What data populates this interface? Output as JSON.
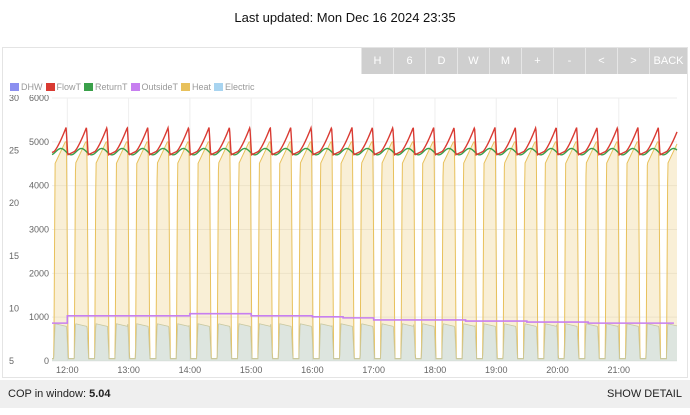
{
  "header": {
    "last_updated": "Last updated: Mon Dec 16 2024 23:35"
  },
  "toolbar": {
    "buttons": [
      "H",
      "6",
      "D",
      "W",
      "M",
      "+",
      "-",
      "<",
      ">",
      "BACK"
    ]
  },
  "footer": {
    "cop_label": "COP in window:",
    "cop_value": "5.04",
    "show_detail": "SHOW DETAIL"
  },
  "chart_data": {
    "type": "line",
    "series": [
      {
        "name": "DHW",
        "color": "#8b8ff0"
      },
      {
        "name": "FlowT",
        "color": "#d93a32",
        "axis": "left",
        "cycle_range": [
          24.6,
          27.2
        ]
      },
      {
        "name": "ReturnT",
        "color": "#3aa04a",
        "axis": "left",
        "cycle_range": [
          24.6,
          25.2
        ]
      },
      {
        "name": "OutsideT",
        "color": "#c77ff0",
        "axis": "left",
        "x": [
          11.75,
          12.0,
          13.5,
          14.0,
          14.5,
          15.0,
          15.5,
          16.0,
          16.5,
          17.0,
          17.5,
          18.0,
          18.5,
          19.0,
          19.5,
          20.0,
          20.5,
          21.0,
          21.5,
          21.9
        ],
        "values": [
          8.6,
          9.3,
          9.3,
          9.5,
          9.5,
          9.3,
          9.3,
          9.2,
          9.1,
          8.9,
          8.9,
          8.9,
          8.8,
          8.8,
          8.7,
          8.7,
          8.6,
          8.6,
          8.6,
          8.6
        ]
      },
      {
        "name": "Heat",
        "color": "#e8c15c",
        "axis": "right",
        "cycle_range": [
          50,
          5000
        ]
      },
      {
        "name": "Electric",
        "color": "#a8d4f0",
        "axis": "right",
        "cycle_range": [
          60,
          850
        ]
      }
    ],
    "x_ticks": [
      "12:00",
      "13:00",
      "14:00",
      "15:00",
      "16:00",
      "17:00",
      "18:00",
      "19:00",
      "20:00",
      "21:00"
    ],
    "x_tick_values": [
      12,
      13,
      14,
      15,
      16,
      17,
      18,
      19,
      20,
      21
    ],
    "xlim": [
      11.75,
      21.95
    ],
    "y_left_ticks": [
      5,
      10,
      15,
      20,
      25,
      30
    ],
    "y_left_lim": [
      5,
      30
    ],
    "y_right_ticks": [
      0,
      1000,
      2000,
      3000,
      4000,
      5000,
      6000
    ],
    "y_right_lim": [
      0,
      6000
    ],
    "cycle_period_hours": 0.3333,
    "grid": true,
    "legend_position": "top-left"
  }
}
